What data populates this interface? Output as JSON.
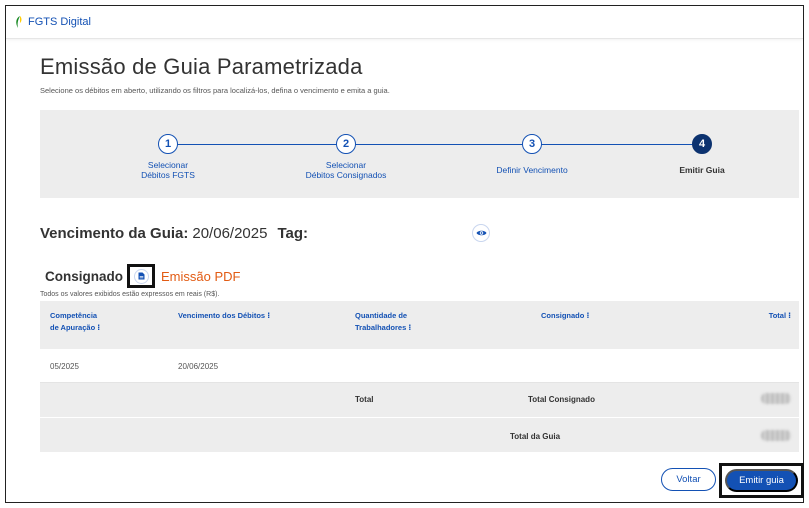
{
  "header": {
    "brand": "FGTS Digital",
    "brand_colors": {
      "leaf_green": "#168821",
      "leaf_yellow": "#ffcd07"
    }
  },
  "page": {
    "title": "Emissão de Guia Parametrizada",
    "subtitle": "Selecione os débitos em aberto, utilizando os filtros para localizá-los, defina o vencimento e emita a guia."
  },
  "stepper": {
    "steps": [
      {
        "number": "1",
        "line1": "Selecionar",
        "line2": "Débitos FGTS",
        "active": false
      },
      {
        "number": "2",
        "line1": "Selecionar",
        "line2": "Débitos Consignados",
        "active": false
      },
      {
        "number": "3",
        "line1": "Definir Vencimento",
        "line2": "",
        "active": false
      },
      {
        "number": "4",
        "line1": "Emitir Guia",
        "line2": "",
        "active": true
      }
    ]
  },
  "vencimento": {
    "label": "Vencimento da Guia:",
    "value": "20/06/2025",
    "tag_label": "Tag:"
  },
  "consignado": {
    "label": "Consignado",
    "pdf_link": "Emissão PDF",
    "icon": "document-icon"
  },
  "note": "Todos os valores exibidos estão expressos em reais (R$).",
  "table": {
    "headers": {
      "competencia_1": "Competência",
      "competencia_2": "de Apuração",
      "vencimento": "Vencimento dos Débitos",
      "quantidade_1": "Quantidade de",
      "quantidade_2": "Trabalhadores",
      "consignado": "Consignado",
      "total": "Total"
    },
    "row": {
      "competencia": "05/2025",
      "vencimento": "20/06/2025"
    },
    "totals_row": {
      "total_label": "Total",
      "consignado_label": "Total Consignado"
    },
    "guia_row": {
      "label": "Total da Guia"
    }
  },
  "buttons": {
    "voltar": "Voltar",
    "emitir": "Emitir guia"
  },
  "colors": {
    "primary": "#1351b4",
    "dark_primary": "#0c326f",
    "accent_orange": "#e25b13",
    "panel_gray": "#ededed"
  }
}
